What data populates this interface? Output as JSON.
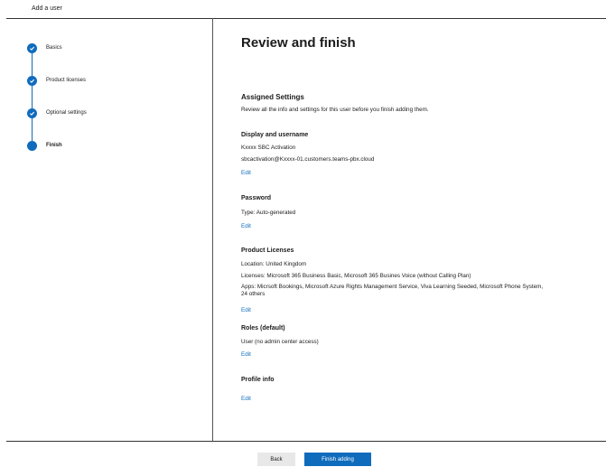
{
  "header": {
    "title": "Add a user"
  },
  "steps": [
    {
      "label": "Basics",
      "state": "done"
    },
    {
      "label": "Product licenses",
      "state": "done"
    },
    {
      "label": "Optional settings",
      "state": "done"
    },
    {
      "label": "Finish",
      "state": "current"
    }
  ],
  "colors": {
    "accent": "#0f6cbd",
    "text": "#1b1b1b",
    "divider": "#333333"
  },
  "main": {
    "title": "Review and finish",
    "assigned": {
      "heading": "Assigned Settings",
      "description": "Review all the info and settings for this user before you finish adding them."
    },
    "display": {
      "heading": "Display and username",
      "name": "Kxxxx SBC Activation",
      "username": "sbcactivation@Kxxxx-01.customers.teams-pbx.cloud",
      "edit": "Edit"
    },
    "password": {
      "heading": "Password",
      "type": "Type: Auto-generated",
      "edit": "Edit"
    },
    "licenses": {
      "heading": "Product Licenses",
      "location": "Location: United Kingdom",
      "licenses": "Licenses: Microsoft 365 Business Basic, Microsoft 365 Busines Voice (without Calling Plan)",
      "apps": "Apps: Micrsoft Bookings, Microsoft Azure Rights Management Service, Viva Learning Seeded, Microsoft Phone System, 24 others",
      "edit": "Edit"
    },
    "roles": {
      "heading": "Roles (default)",
      "value": "User (no admin center access)",
      "edit": "Edit"
    },
    "profile": {
      "heading": "Profile info",
      "edit": "Edit"
    }
  },
  "footer": {
    "back": "Back",
    "finish": "Finish adding"
  }
}
